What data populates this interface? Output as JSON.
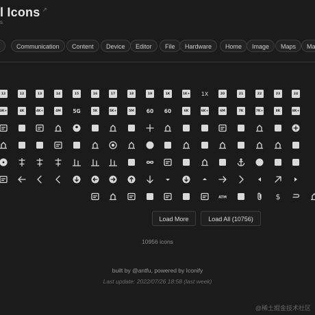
{
  "header": {
    "title": "l Icons",
    "title_badge": "↗",
    "subtitle": "s"
  },
  "categories": [
    "V",
    "Communication",
    "Content",
    "Device",
    "Editor",
    "File",
    "Hardware",
    "Home",
    "Image",
    "Maps",
    "Ma"
  ],
  "icons": [
    [
      "12-mp",
      "12-mp",
      "13-mp",
      "14-mp",
      "15-mp",
      "16-mp",
      "17-mp",
      "18-mp",
      "19-mp",
      "1k",
      "1k-plus",
      "1x",
      "20-mp",
      "21-mp",
      "22-mp",
      "23-mp",
      "24-mp"
    ],
    [
      "3k-plus",
      "4k",
      "4k-plus",
      "4mp",
      "5g",
      "5k",
      "5k-plus",
      "5mp",
      "60fps",
      "60fps-select",
      "6k",
      "6k-plus",
      "6mp",
      "7k",
      "7k-plus",
      "8k",
      "8k-plus"
    ],
    [
      "accessible",
      "account-balance",
      "account-balance-wallet",
      "account-box",
      "account-circle",
      "account-tree",
      "ad-units",
      "adb",
      "add",
      "add-a-photo",
      "add-alarm",
      "add-alert",
      "add-box",
      "add-business",
      "add-card",
      "add-chart",
      "add-circle"
    ],
    [
      "add-road",
      "add-to-drive",
      "add-to-home-screen",
      "add-to-photos",
      "add-to-queue",
      "adf-scanner",
      "adjust",
      "admin-panel-settings",
      "adobe",
      "ads-click",
      "agriculture",
      "air",
      "airline-seat-flat",
      "airline-seat-flat-angled",
      "airline-seat-individual-suite",
      "airline-seat-legroom-extra",
      "airline-seat-legroom-normal"
    ],
    [
      "album",
      "align-horizontal-center",
      "align-horizontal-left",
      "align-horizontal-right",
      "align-vertical-bottom",
      "align-vertical-center",
      "align-vertical-top",
      "all-inbox",
      "all-inclusive",
      "all-out",
      "alt-route",
      "amp-stories",
      "analytics",
      "anchor",
      "android",
      "animation",
      "announcement"
    ],
    [
      "area-chart",
      "arrow-back",
      "arrow-back-ios",
      "arrow-back-ios-new",
      "arrow-circle-down",
      "arrow-circle-left",
      "arrow-circle-right",
      "arrow-circle-up",
      "arrow-downward",
      "arrow-drop-down",
      "arrow-drop-down-circle",
      "arrow-drop-up",
      "arrow-forward",
      "arrow-forward-ios",
      "arrow-left",
      "arrow-outward",
      "arrow-right"
    ],
    [
      "assignment-returned",
      "assignment-turned-in",
      "assist-walker",
      "assistant",
      "assistant-direction",
      "assistant-photo",
      "assured-workload",
      "atm",
      "attach-email",
      "attach-file",
      "attach-money",
      "attachment",
      "attractions"
    ]
  ],
  "buttons": {
    "load_more": "Load More",
    "load_all": "Load All (10756)"
  },
  "count_text": "10956 icons",
  "footer": {
    "built_prefix": "built by ",
    "author": "@antfu",
    "powered_prefix": ", powered by ",
    "powered_by": "Iconify",
    "last_update": "Last update: 2022/07/26 18:58 (last week)"
  },
  "watermark": "@稀土掘金技术社区",
  "colors": {
    "background": "#1b1b1b",
    "icon": "#d9d9d9",
    "text": "#d6d6d6",
    "muted": "#8c8c8c",
    "border": "#3c3c3c"
  }
}
